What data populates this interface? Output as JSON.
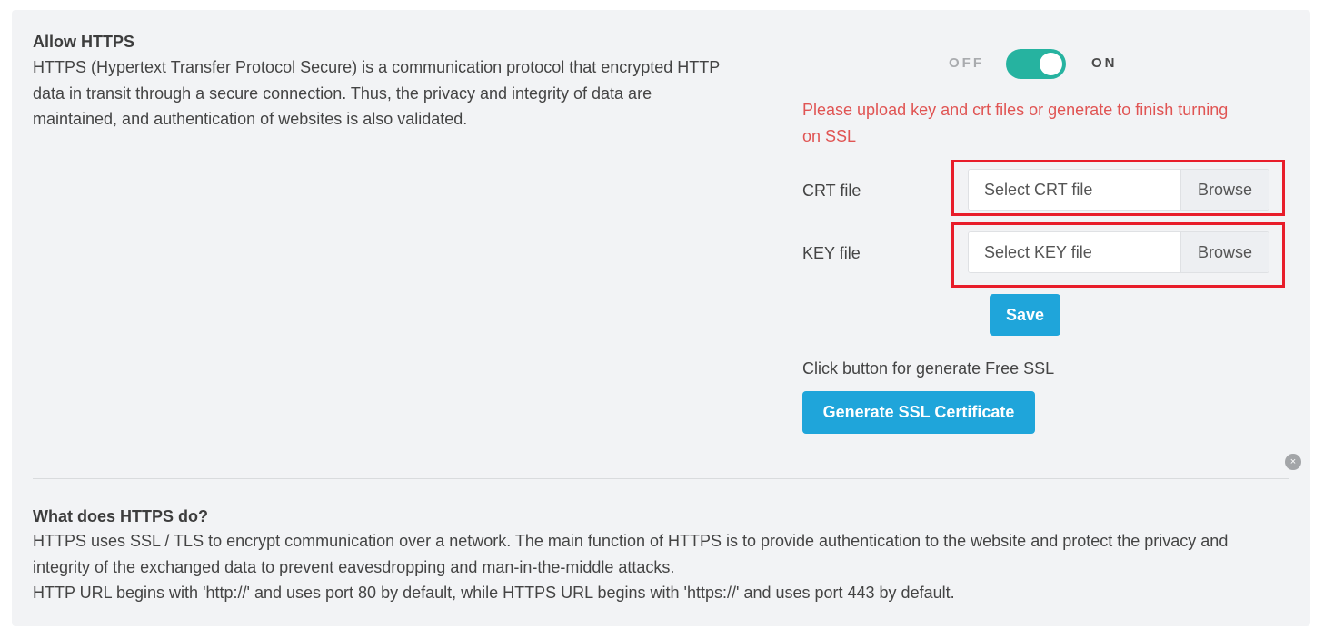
{
  "allow_https": {
    "title": "Allow HTTPS",
    "description_lines": [
      "HTTPS (Hypertext Transfer Protocol Secure) is a communication protocol that encrypted HTTP",
      "data in transit through a secure connection. Thus, the privacy and integrity of data are",
      "maintained, and authentication of websites is also validated."
    ]
  },
  "toggle": {
    "off_label": "OFF",
    "on_label": "ON",
    "state": "on",
    "accent_color": "#26b3a0"
  },
  "warning": {
    "lines": [
      "Please upload key and crt files or generate to finish turning",
      "on SSL"
    ],
    "color": "#e05453"
  },
  "crt": {
    "label": "CRT file",
    "placeholder": "Select CRT file",
    "browse_label": "Browse"
  },
  "key": {
    "label": "KEY file",
    "placeholder": "Select KEY file",
    "browse_label": "Browse"
  },
  "save_label": "Save",
  "generate": {
    "hint": "Click button for generate Free SSL",
    "button_label": "Generate SSL Certificate"
  },
  "close_icon_glyph": "×",
  "info": {
    "title": "What does HTTPS do?",
    "lines": [
      "HTTPS uses SSL / TLS to encrypt communication over a network. The main function of HTTPS is to provide authentication to the website and protect the privacy and",
      "integrity of the exchanged data to prevent eavesdropping and man-in-the-middle attacks.",
      "HTTP URL begins with 'http://' and uses port 80 by default, while HTTPS URL begins with 'https://' and uses port 443 by default."
    ]
  },
  "colors": {
    "button_blue": "#1fa5da",
    "highlight_red": "#e81d2a",
    "panel_bg": "#f2f3f5"
  }
}
